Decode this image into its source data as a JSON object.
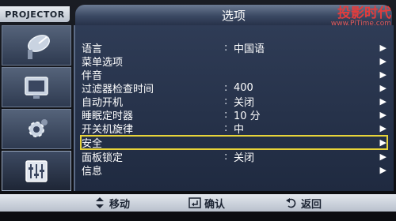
{
  "brand": "PROJECTOR",
  "title": "选项",
  "watermark": {
    "line1": "投影时代",
    "line2": "www.PjTime.com"
  },
  "sidebar": [
    {
      "icon": "satellite-dish-icon"
    },
    {
      "icon": "picture-icon"
    },
    {
      "icon": "gear-icon"
    },
    {
      "icon": "equalizer-icon",
      "active": true
    }
  ],
  "menu": [
    {
      "label": "语言",
      "value": "中国语",
      "colon": ":",
      "arrow": "▶"
    },
    {
      "label": "菜单选项",
      "value": "",
      "colon": "",
      "arrow": "▶"
    },
    {
      "label": "伴音",
      "value": "",
      "colon": "",
      "arrow": "▶"
    },
    {
      "label": "过滤器检查时间",
      "value": "400",
      "colon": ":",
      "arrow": "▶"
    },
    {
      "label": "自动开机",
      "value": "关闭",
      "colon": ":",
      "arrow": "▶"
    },
    {
      "label": "睡眠定时器",
      "value": "10 分",
      "colon": ":",
      "arrow": "▶"
    },
    {
      "label": "开关机旋律",
      "value": "中",
      "colon": ":",
      "arrow": "▶"
    },
    {
      "label": "安全",
      "value": "",
      "colon": "",
      "arrow": "▶",
      "selected": true
    },
    {
      "label": "面板锁定",
      "value": "关闭",
      "colon": ":",
      "arrow": "▶"
    },
    {
      "label": "信息",
      "value": "",
      "colon": "",
      "arrow": "▶"
    }
  ],
  "hints": {
    "move": "移动",
    "confirm": "确认",
    "back": "返回"
  },
  "colors": {
    "accent": "#e8d43a",
    "panel": "#2f3c56"
  }
}
